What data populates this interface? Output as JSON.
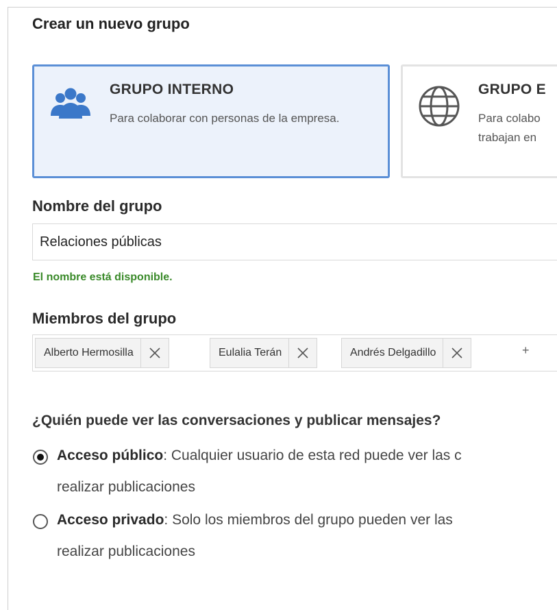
{
  "form": {
    "title": "Crear un nuevo grupo"
  },
  "group_types": {
    "internal": {
      "title": "GRUPO INTERNO",
      "description": "Para colaborar con personas de la empresa.",
      "icon": "people-group-icon",
      "selected": true
    },
    "external": {
      "title": "GRUPO E",
      "description_line1": "Para colabo",
      "description_line2": "trabajan en",
      "icon": "globe-icon",
      "selected": false
    }
  },
  "group_name": {
    "label": "Nombre del grupo",
    "value": "Relaciones públicas",
    "status": "El nombre está disponible."
  },
  "members": {
    "label": "Miembros del grupo",
    "items": [
      {
        "name": "Alberto Hermosilla"
      },
      {
        "name": "Eulalia Terán"
      },
      {
        "name": "Andrés Delgadillo"
      }
    ],
    "add_label": "+"
  },
  "access": {
    "question": "¿Quién puede ver las conversaciones y publicar mensajes?",
    "options": [
      {
        "title": "Acceso público",
        "description_line1": ": Cualquier usuario de esta red puede ver las c",
        "description_line2": "realizar publicaciones",
        "checked": true
      },
      {
        "title": "Acceso privado",
        "description_line1": ": Solo los miembros del grupo pueden ver las",
        "description_line2": "realizar publicaciones",
        "checked": false
      }
    ]
  },
  "colors": {
    "selected_border": "#5b8fd6",
    "selected_bg": "#ecf2fb",
    "success_text": "#3a8a2a",
    "icon_blue": "#3b78c9"
  }
}
